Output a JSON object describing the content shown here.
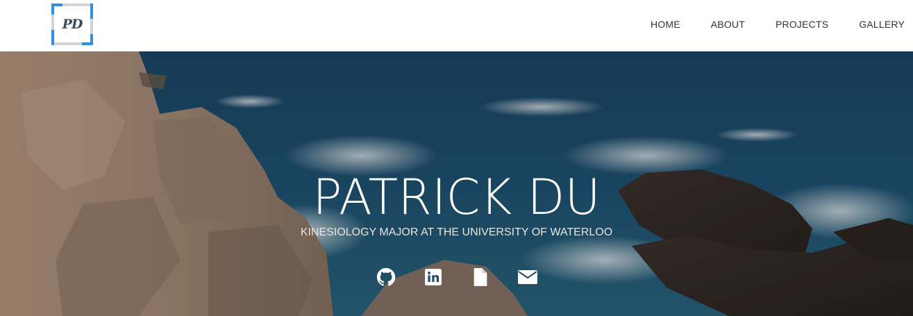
{
  "logo": {
    "text": "PD",
    "accent_color": "#2f8fe0"
  },
  "nav": {
    "items": [
      {
        "label": "HOME"
      },
      {
        "label": "ABOUT"
      },
      {
        "label": "PROJECTS"
      },
      {
        "label": "GALLERY"
      }
    ]
  },
  "hero": {
    "title": "PATRICK DU",
    "subtitle": "KINESIOLOGY MAJOR AT THE UNIVERSITY OF WATERLOO",
    "social": [
      {
        "icon": "github-icon"
      },
      {
        "icon": "linkedin-icon"
      },
      {
        "icon": "document-icon"
      },
      {
        "icon": "email-icon"
      }
    ]
  },
  "colors": {
    "text_light": "#ffffff",
    "nav_text": "#333333"
  }
}
